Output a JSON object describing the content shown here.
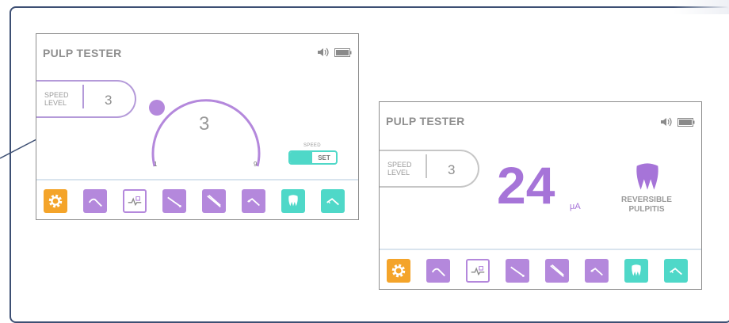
{
  "colors": {
    "frame": "#3d4f73",
    "accent_purple": "#b488dc",
    "accent_teal": "#4fd8c8",
    "accent_orange": "#f4a42a",
    "reading_purple": "#a674d8",
    "text_gray": "#8f8f8f"
  },
  "screen_left": {
    "title": "PULP TESTER",
    "status_icons": [
      "speaker-icon",
      "battery-icon"
    ],
    "speed": {
      "label_line1": "SPEED",
      "label_line2": "LEVEL",
      "value": "3"
    },
    "dial": {
      "value": "3",
      "min_label": "1",
      "max_label": "9",
      "level": 3,
      "min": 1,
      "max": 9
    },
    "speed_toggle": {
      "label": "SPEED",
      "button_label": "SET"
    },
    "toolbar": [
      {
        "icon": "gear-icon",
        "style": "orange"
      },
      {
        "icon": "probe-icon",
        "style": "purple"
      },
      {
        "icon": "graph-tooth-icon",
        "style": "outline"
      },
      {
        "icon": "scaler-icon",
        "style": "purple"
      },
      {
        "icon": "forceps-icon",
        "style": "purple"
      },
      {
        "icon": "electrode-icon",
        "style": "purple"
      },
      {
        "icon": "tooth-icon",
        "style": "teal"
      },
      {
        "icon": "electrode-icon",
        "style": "teal"
      }
    ]
  },
  "screen_right": {
    "title": "PULP TESTER",
    "status_icons": [
      "speaker-icon",
      "battery-icon"
    ],
    "speed": {
      "label_line1": "SPEED",
      "label_line2": "LEVEL",
      "value": "3"
    },
    "reading": {
      "value": "24",
      "unit": "µA"
    },
    "diagnosis": {
      "line1": "REVERSIBLE",
      "line2": "PULPITIS"
    },
    "toolbar": [
      {
        "icon": "gear-icon",
        "style": "orange"
      },
      {
        "icon": "probe-icon",
        "style": "purple"
      },
      {
        "icon": "graph-tooth-icon",
        "style": "outline"
      },
      {
        "icon": "scaler-icon",
        "style": "purple"
      },
      {
        "icon": "forceps-icon",
        "style": "purple"
      },
      {
        "icon": "electrode-icon",
        "style": "purple"
      },
      {
        "icon": "tooth-icon",
        "style": "teal"
      },
      {
        "icon": "electrode-icon",
        "style": "teal"
      }
    ]
  }
}
